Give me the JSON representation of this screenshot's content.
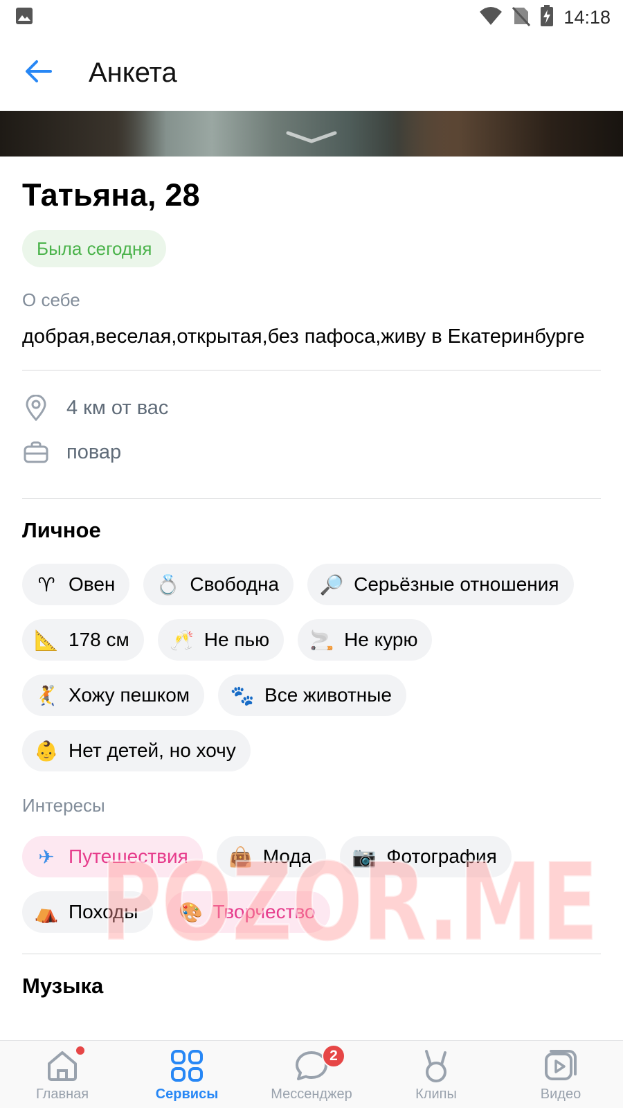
{
  "status_bar": {
    "time": "14:18"
  },
  "header": {
    "title": "Анкета"
  },
  "profile": {
    "name_age": "Татьяна, 28",
    "online_status": "Была сегодня",
    "about_label": "О себе",
    "about_text": "добрая,веселая,открытая,без пафоса,живу в Екатеринбурге",
    "distance": "4 км от вас",
    "job": "повар"
  },
  "personal": {
    "title": "Личное",
    "chips": [
      {
        "icon": "aries-icon",
        "emoji": "♈",
        "label": "Овен"
      },
      {
        "icon": "ring-icon",
        "emoji": "💍",
        "label": "Свободна"
      },
      {
        "icon": "magnifier-icon",
        "emoji": "🔎",
        "label": "Серьёзные отношения"
      },
      {
        "icon": "ruler-icon",
        "emoji": "📐",
        "label": "178 см"
      },
      {
        "icon": "champagne-icon",
        "emoji": "🥂",
        "label": "Не пью"
      },
      {
        "icon": "cigarette-icon",
        "emoji": "🚬",
        "label": "Не курю"
      },
      {
        "icon": "walking-icon",
        "emoji": "🤾",
        "label": "Хожу пешком"
      },
      {
        "icon": "paw-icon",
        "emoji": "🐾",
        "label": "Все животные"
      },
      {
        "icon": "baby-icon",
        "emoji": "👶",
        "label": "Нет детей, но хочу"
      }
    ]
  },
  "interests": {
    "title": "Интересы",
    "chips": [
      {
        "icon": "airplane-icon",
        "emoji": "✈",
        "label": "Путешествия",
        "highlight": true
      },
      {
        "icon": "handbag-icon",
        "emoji": "👜",
        "label": "Мода",
        "highlight": false
      },
      {
        "icon": "camera-icon",
        "emoji": "📷",
        "label": "Фотография",
        "highlight": false
      },
      {
        "icon": "tent-icon",
        "emoji": "⛺",
        "label": "Походы",
        "highlight": false
      },
      {
        "icon": "palette-icon",
        "emoji": "🎨",
        "label": "Творчество",
        "highlight": true
      }
    ]
  },
  "music": {
    "title": "Музыка"
  },
  "watermark": "POZOR.ME",
  "tabs": [
    {
      "label": "Главная",
      "icon": "home-icon"
    },
    {
      "label": "Сервисы",
      "icon": "services-icon",
      "active": true
    },
    {
      "label": "Мессенджер",
      "icon": "messenger-icon",
      "badge": "2"
    },
    {
      "label": "Клипы",
      "icon": "clips-icon"
    },
    {
      "label": "Видео",
      "icon": "video-icon"
    }
  ],
  "colors": {
    "accent": "#2787f5",
    "online": "#4bb34b",
    "pink": "#e63c8c",
    "badge": "#e64646"
  }
}
